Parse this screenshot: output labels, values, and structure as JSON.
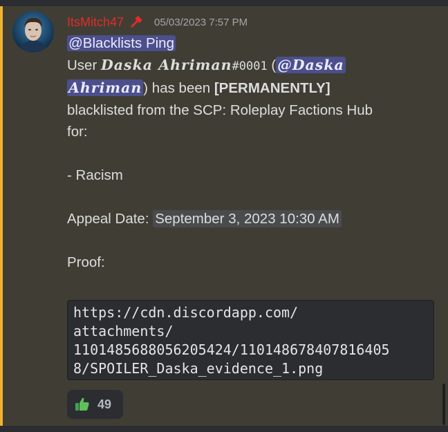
{
  "message": {
    "author": "ItsMitch47",
    "timestamp": "05/03/2023 7:57 PM",
    "colors": {
      "author": "#e02b2b",
      "mention_bg": "#4c4f8b",
      "highlight_strip": "#f0b232"
    },
    "content": {
      "role_mention": "@Blacklists Ping",
      "user_word": "User",
      "blacklisted_name": "Daska Ahriman",
      "discriminator": "#0001",
      "open_paren": "(",
      "user_mention_line1": "@Daska",
      "user_mention_line2": "Ahriman",
      "has_been": ") has been",
      "permanently": "[PERMANENTLY]",
      "blacklist_text": "blacklisted from the SCP: Roleplay Factions Hub",
      "for_text": "for:",
      "reason": "- Racism",
      "appeal_label": "Appeal Date:",
      "appeal_date": "September 3, 2023 10:30 AM",
      "proof_label": "Proof:",
      "code_lines": [
        "https://cdn.discordapp.com/",
        "attachments/",
        "1101485688056205424/110148678407816405",
        "8/SPOILER_Daska_evidence_1.png"
      ]
    },
    "reaction": {
      "icon": "thumbs-up-icon",
      "count": "49"
    }
  }
}
